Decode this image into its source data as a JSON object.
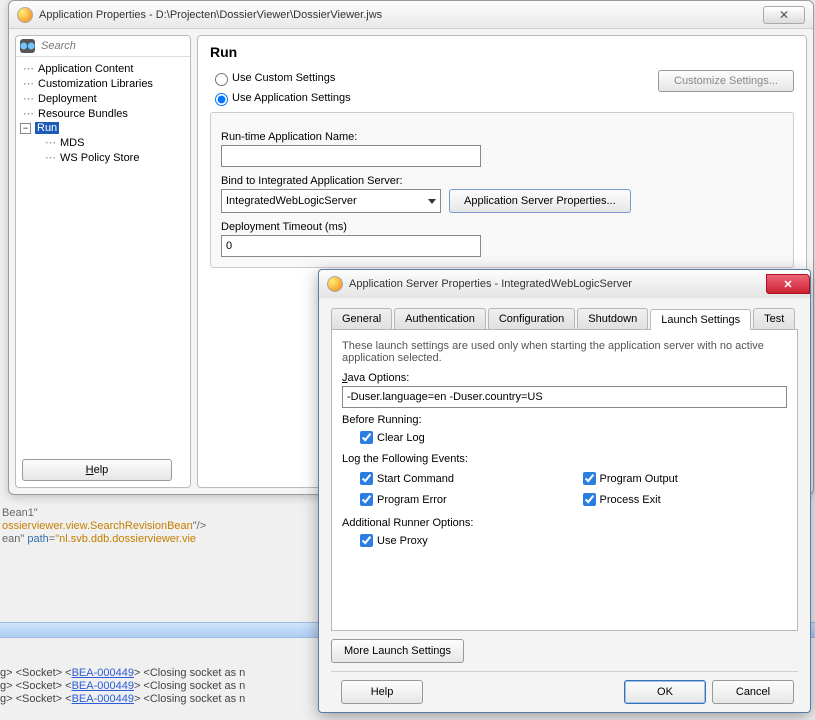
{
  "main_window": {
    "title": "Application Properties - D:\\Projecten\\DossierViewer\\DossierViewer.jws",
    "close_glyph": "✕"
  },
  "search": {
    "placeholder": "Search"
  },
  "tree": {
    "items": [
      "Application Content",
      "Customization Libraries",
      "Deployment",
      "Resource Bundles"
    ],
    "run_label": "Run",
    "run_children": [
      "MDS",
      "WS Policy Store"
    ],
    "expander_glyph": "−"
  },
  "help_btn": "Help",
  "right": {
    "heading": "Run",
    "radio_custom": "Use Custom Settings",
    "radio_app": "Use Application Settings",
    "customize_btn": "Customize Settings...",
    "runtime_label": "Run-time Application Name:",
    "runtime_value": "",
    "bind_label": "Bind to Integrated Application Server:",
    "bind_value": "IntegratedWebLogicServer",
    "app_srv_btn": "Application Server Properties...",
    "timeout_label": "Deployment Timeout (ms)",
    "timeout_value": "0"
  },
  "dialog": {
    "title": "Application Server Properties - IntegratedWebLogicServer",
    "close_glyph": "✕",
    "tabs": [
      "General",
      "Authentication",
      "Configuration",
      "Shutdown",
      "Launch Settings",
      "Test"
    ],
    "active_tab_index": 4,
    "hint": "These launch settings are used only when starting the application server with no active application selected.",
    "java_options_label": "Java Options:",
    "java_options_value": "-Duser.language=en -Duser.country=US",
    "before_running_label": "Before Running:",
    "clear_log": "Clear Log",
    "log_events_label": "Log the Following Events:",
    "start_command": "Start Command",
    "program_output": "Program Output",
    "program_error": "Program Error",
    "process_exit": "Process Exit",
    "additional_runner_label": "Additional Runner Options:",
    "use_proxy": "Use Proxy",
    "more_btn": "More Launch Settings",
    "help_btn": "Help",
    "ok_btn": "OK",
    "cancel_btn": "Cancel"
  },
  "bg_code": {
    "line1": "Bean1\"",
    "line2a": "ossierviewer.view.SearchRevisionBean",
    "line2b": "\"/>",
    "line3a": "ean\" ",
    "line3b": "path",
    "line3c": "=",
    "line3d": "\"nl.svb.ddb.dossierviewer.vie"
  },
  "bg_log": {
    "l1a": "g> <Socket> <",
    "l1b": "BEA-000449",
    "l1c": "> <Closing socket as n",
    "l2a": "g> <Socket> <",
    "l2b": "BEA-000449",
    "l2c": "> <Closing socket as n",
    "l3a": "g> <Socket> <",
    "l3b": "BEA-000449",
    "l3c": "> <Closing socket as n"
  }
}
